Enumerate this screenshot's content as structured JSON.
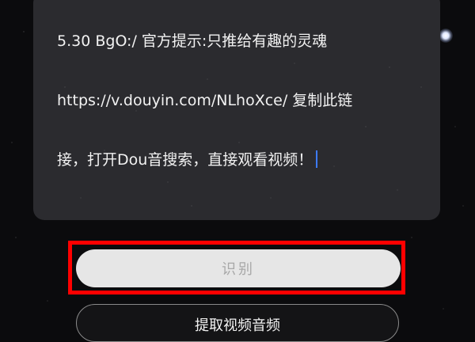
{
  "input": {
    "lines": [
      "5.30 BgO:/ 官方提示:只推给有趣的灵魂",
      "https://v.douyin.com/NLhoXce/ 复制此链",
      "接，打开Dou音搜索，直接观看视频！"
    ]
  },
  "buttons": {
    "recognize_label": "识别",
    "extract_audio_label": "提取视频音频"
  },
  "colors": {
    "highlight": "#ff0000",
    "cursor": "#3d7bff"
  },
  "icons": {
    "clear": "close-circle-icon"
  }
}
